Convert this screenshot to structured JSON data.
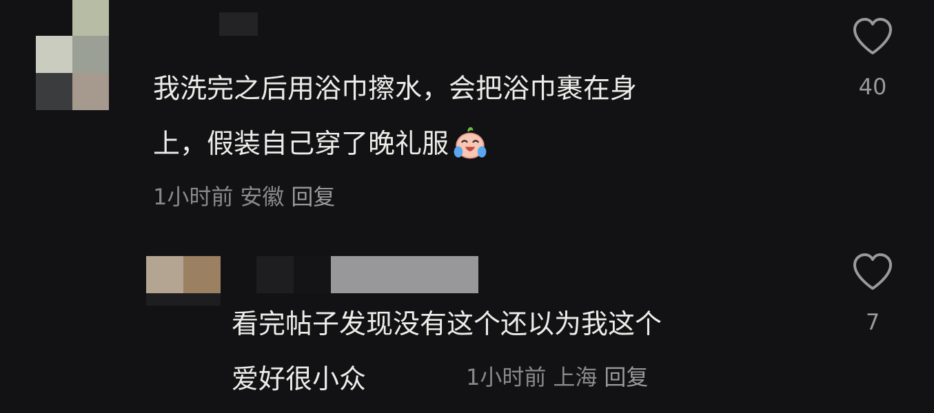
{
  "comments": [
    {
      "lines": [
        "我洗完之后用浴巾擦水，会把浴巾裹在身",
        "上，假装自己穿了晚礼服"
      ],
      "emoji": "laughing-crying-emoji",
      "time": "1小时前",
      "location": "安徽",
      "reply_label": "回复",
      "likes": "40"
    },
    {
      "lines": [
        "看完帖子发现没有这个还以为我这个",
        "爱好很小众"
      ],
      "time": "1小时前",
      "location": "上海",
      "reply_label": "回复",
      "likes": "7"
    }
  ],
  "icons": {
    "like": "heart-outline-icon"
  },
  "colors": {
    "background": "#121214",
    "text": "#ecece9",
    "meta": "#8a8a8c"
  }
}
